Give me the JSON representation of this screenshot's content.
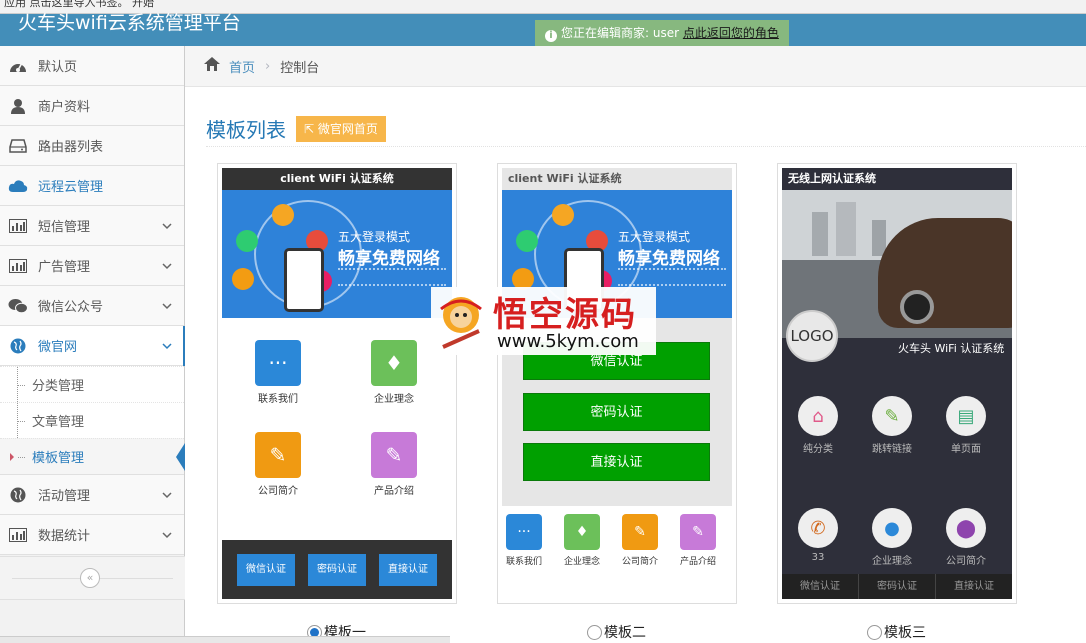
{
  "browser": {
    "bookmark_hint": "应用   点击这里导入书签。   开始"
  },
  "header": {
    "app_title": "火车头wifi云系统管理平台",
    "notice_text": "您正在编辑商家: user ",
    "notice_link": "点此返回您的角色"
  },
  "sidebar": {
    "items": [
      {
        "label": "默认页",
        "icon": "dashboard-icon"
      },
      {
        "label": "商户资料",
        "icon": "user-icon"
      },
      {
        "label": "路由器列表",
        "icon": "hdd-icon"
      },
      {
        "label": "远程云管理",
        "icon": "cloud-icon"
      },
      {
        "label": "短信管理",
        "icon": "bar-chart-icon"
      },
      {
        "label": "广告管理",
        "icon": "bar-chart-icon"
      },
      {
        "label": "微信公众号",
        "icon": "wechat-icon"
      },
      {
        "label": "微官网",
        "icon": "globe-icon"
      },
      {
        "label": "活动管理",
        "icon": "globe-icon"
      },
      {
        "label": "数据统计",
        "icon": "bar-chart-icon"
      }
    ],
    "submenu": [
      "分类管理",
      "文章管理",
      "模板管理"
    ]
  },
  "breadcrumb": {
    "home": "首页",
    "current": "控制台"
  },
  "page": {
    "title": "模板列表",
    "wx_button": "微官网首页"
  },
  "templates": [
    {
      "title": "client WiFi 认证系统",
      "banner_line1": "五大登录模式",
      "banner_line2": "畅享免费网络",
      "tiles": [
        "联系我们",
        "企业理念",
        "公司简介",
        "产品介绍"
      ],
      "buttons": [
        "微信认证",
        "密码认证",
        "直接认证"
      ],
      "option": "模板一",
      "selected": true
    },
    {
      "title": "client WiFi 认证系统",
      "banner_line1": "五大登录模式",
      "banner_line2": "畅享免费网络",
      "buttons": [
        "微信认证",
        "密码认证",
        "直接认证"
      ],
      "tiles": [
        "联系我们",
        "企业理念",
        "公司简介",
        "产品介绍"
      ],
      "option": "模板二",
      "selected": false
    },
    {
      "title": "无线上网认证系统",
      "logo": "LOGO",
      "subtitle": "火车头 WiFi 认证系统",
      "tiles": [
        "纯分类",
        "跳转链接",
        "单页面",
        "33",
        "企业理念",
        "公司简介"
      ],
      "buttons": [
        "微信认证",
        "密码认证",
        "直接认证"
      ],
      "option": "模板三",
      "selected": false
    }
  ],
  "watermark": {
    "text": "悟空源码",
    "url": "www.5kym.com"
  },
  "colors": {
    "header": "#438eb9",
    "notice": "#87b87f",
    "accent": "#2b7dbc",
    "green_button": "#00a000",
    "orange_button": "#f7b64a"
  }
}
